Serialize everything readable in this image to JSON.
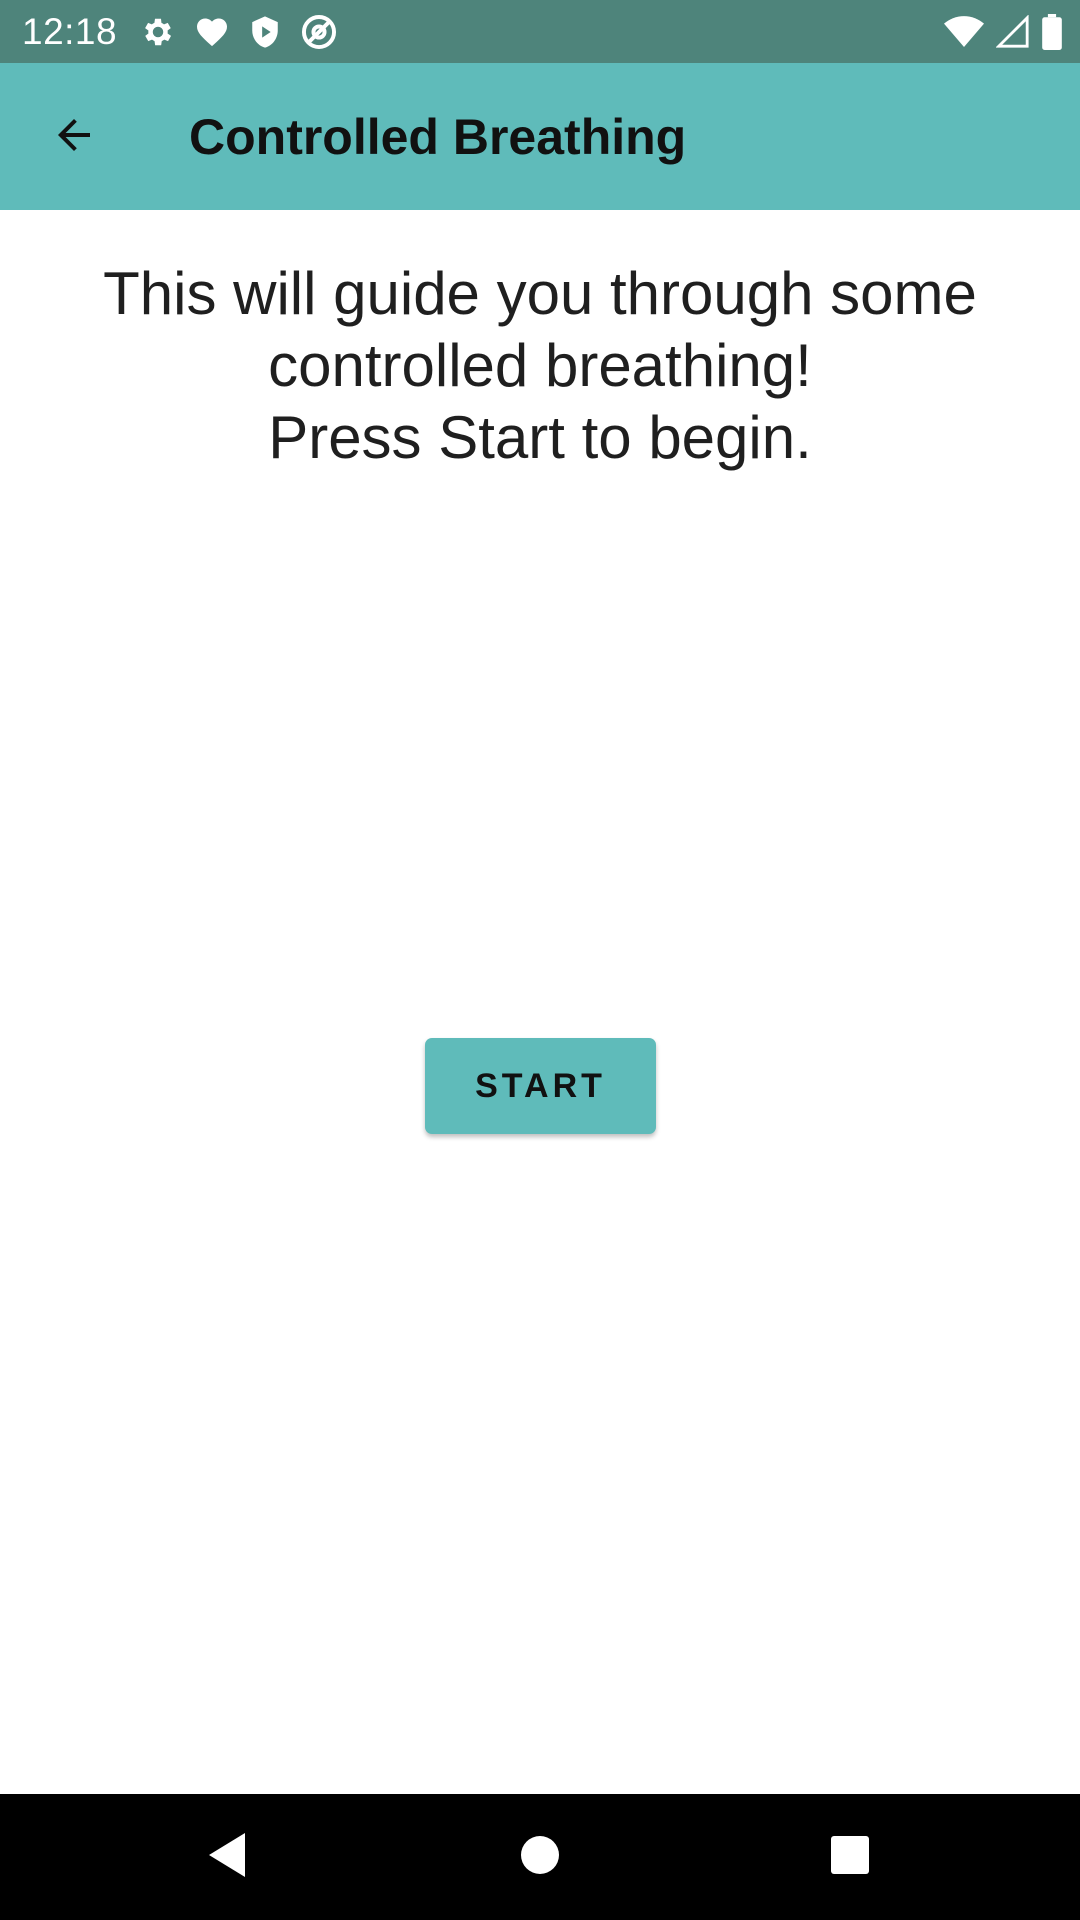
{
  "status_bar": {
    "time": "12:18",
    "left_icons": [
      "settings-icon",
      "heart-icon",
      "shield-play-icon",
      "at-sign-icon"
    ],
    "right_icons": [
      "wifi-icon",
      "cell-signal-icon",
      "battery-icon"
    ],
    "background": "#4e847b"
  },
  "app_bar": {
    "title": "Controlled Breathing",
    "back_icon": "arrow-back-icon",
    "background": "#5fbbba"
  },
  "main": {
    "intro_text": "This will guide you through some\ncontrolled breathing!\n Press Start to begin.",
    "start_label": "START",
    "accent": "#5fbbba"
  },
  "nav_bar": {
    "items": [
      "back-triangle-icon",
      "home-circle-icon",
      "recents-square-icon"
    ]
  }
}
